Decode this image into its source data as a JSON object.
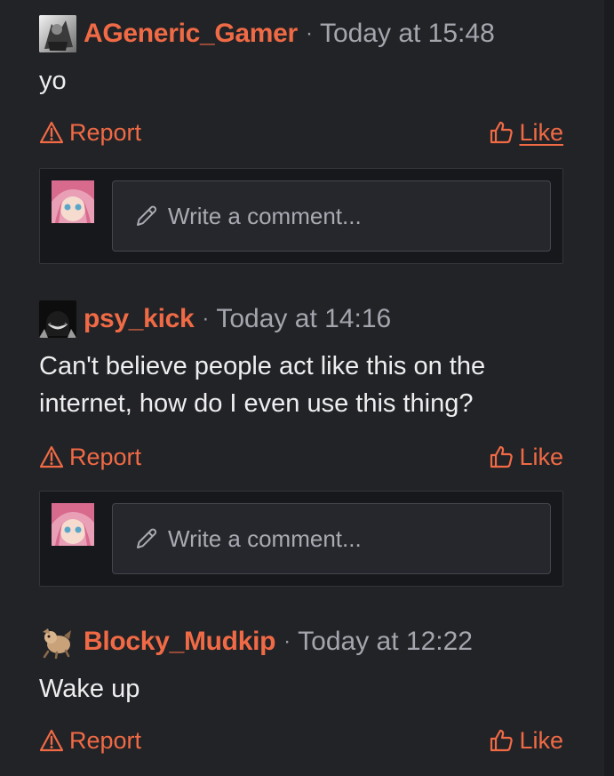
{
  "posts": [
    {
      "username": "AGeneric_Gamer",
      "separator": "·",
      "timestamp": "Today at 15:48",
      "content": "yo",
      "report_label": "Report",
      "like_label": "Like"
    },
    {
      "username": "psy_kick",
      "separator": "·",
      "timestamp": "Today at 14:16",
      "content": "Can't believe people act like this on the\ninternet, how do I even use this thing?",
      "report_label": "Report",
      "like_label": "Like"
    },
    {
      "username": "Blocky_Mudkip",
      "separator": "·",
      "timestamp": "Today at 12:22",
      "content": "Wake up",
      "report_label": "Report",
      "like_label": "Like"
    }
  ],
  "comment_box": {
    "placeholder": "Write a comment..."
  },
  "icons": {
    "report": "warning-triangle-icon",
    "like": "thumbs-up-icon",
    "edit": "pencil-icon"
  },
  "colors": {
    "accent": "#f06a45",
    "background": "#222327",
    "comment_panel": "#17181b"
  }
}
